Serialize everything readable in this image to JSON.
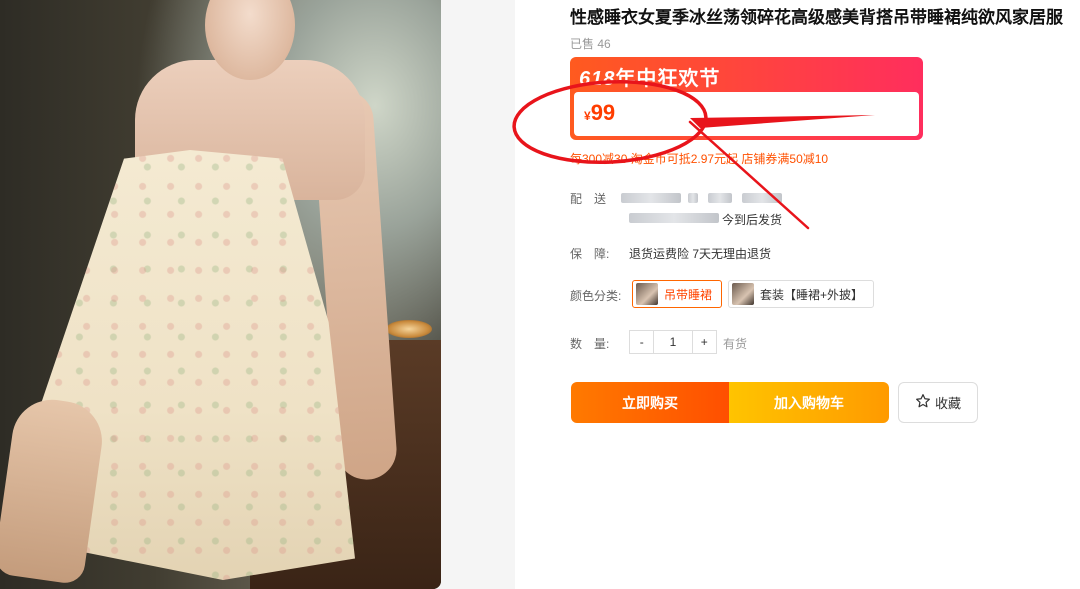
{
  "product": {
    "title": "性感睡衣女夏季冰丝荡领碎花高级感美背搭吊带睡裙纯欲风家居服",
    "sold": "已售 46"
  },
  "promo": {
    "year": "618",
    "title": "年中狂欢节",
    "currency": "¥",
    "price": "99"
  },
  "coupon": "每300减30 淘金币可抵2.97元起 店铺券满50减10",
  "delivery": {
    "label": "配　送",
    "note": "今到后发货"
  },
  "guarantee": {
    "label": "保　障:",
    "value": "退货运费险 7天无理由退货"
  },
  "color": {
    "label": "颜色分类:",
    "options": [
      {
        "label": "吊带睡裙",
        "selected": true
      },
      {
        "label": "套装【睡裙+外披】",
        "selected": false
      }
    ]
  },
  "quantity": {
    "label": "数　量:",
    "minus": "-",
    "value": "1",
    "plus": "+",
    "stock": "有货"
  },
  "actions": {
    "buy": "立即购买",
    "cart": "加入购物车",
    "favorite": "收藏"
  },
  "colors": {
    "accent": "#ff5000",
    "annotation": "#e8141b"
  },
  "icons": {
    "favorite": "star-outline-icon"
  }
}
